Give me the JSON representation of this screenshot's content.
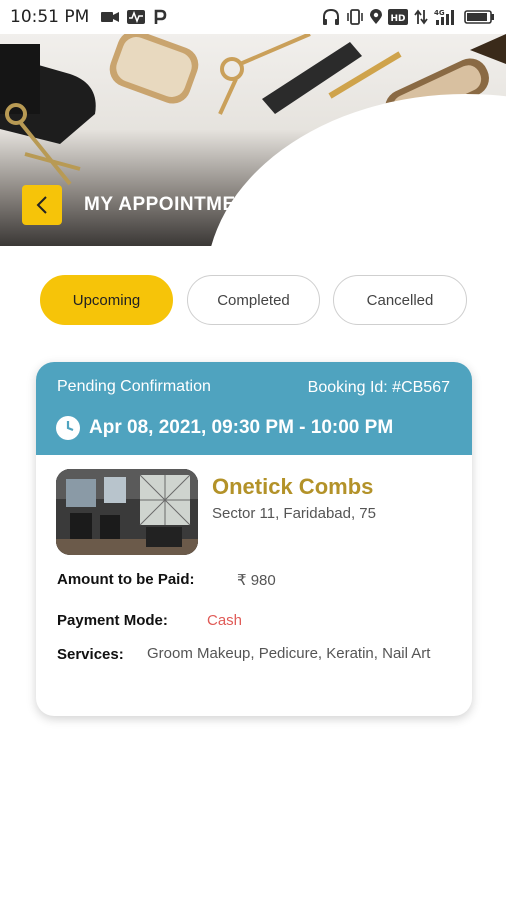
{
  "status_bar": {
    "time": "10:51 PM",
    "network_label": "4G",
    "hd_label": "HD"
  },
  "header": {
    "title": "MY APPOINTMENTS",
    "back_icon": "chevron-left-icon"
  },
  "tabs": [
    {
      "label": "Upcoming",
      "active": true
    },
    {
      "label": "Completed",
      "active": false
    },
    {
      "label": "Cancelled",
      "active": false
    }
  ],
  "appointment": {
    "status": "Pending Confirmation",
    "booking_id": "Booking Id: #CB567",
    "datetime": "Apr 08, 2021, 09:30 PM - 10:00 PM",
    "salon_name": "Onetick Combs",
    "salon_address": "Sector 11, Faridabad, 75",
    "amount_label": "Amount to be Paid:",
    "amount_value": "₹ 980",
    "payment_label": "Payment Mode:",
    "payment_value": "Cash",
    "services_label": "Services:",
    "services_value": "Groom Makeup, Pedicure, Keratin, Nail Art"
  },
  "colors": {
    "accent_yellow": "#f6c409",
    "card_header_blue": "#4fa3bf",
    "salon_name_gold": "#b39229",
    "cash_red": "#e05b57"
  }
}
